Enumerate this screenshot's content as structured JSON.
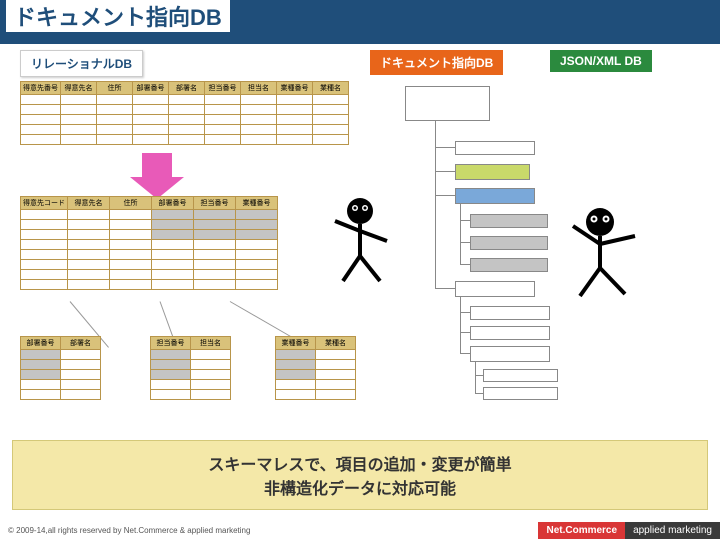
{
  "title": "ドキュメント指向DB",
  "labels": {
    "relational": "リレーショナルDB",
    "document": "ドキュメント指向DB",
    "json": "JSON/XML DB"
  },
  "table1_headers": [
    "得意先番号",
    "得意先名",
    "住所",
    "部署番号",
    "部署名",
    "担当番号",
    "担当名",
    "業種番号",
    "業種名"
  ],
  "table2_headers": [
    "得意先コード",
    "得意先名",
    "住所",
    "部署番号",
    "担当番号",
    "業種番号"
  ],
  "table3a_headers": [
    "部署番号",
    "部署名"
  ],
  "table3b_headers": [
    "担当番号",
    "担当名"
  ],
  "table3c_headers": [
    "業種番号",
    "業種名"
  ],
  "summary_l1": "スキーマレスで、項目の追加・変更が簡単",
  "summary_l2": "非構造化データに対応可能",
  "footer": {
    "copy": "© 2009-14,all rights reserved by Net.Commerce & applied marketing",
    "nc": "Net.Commerce",
    "am": "applied marketing"
  }
}
